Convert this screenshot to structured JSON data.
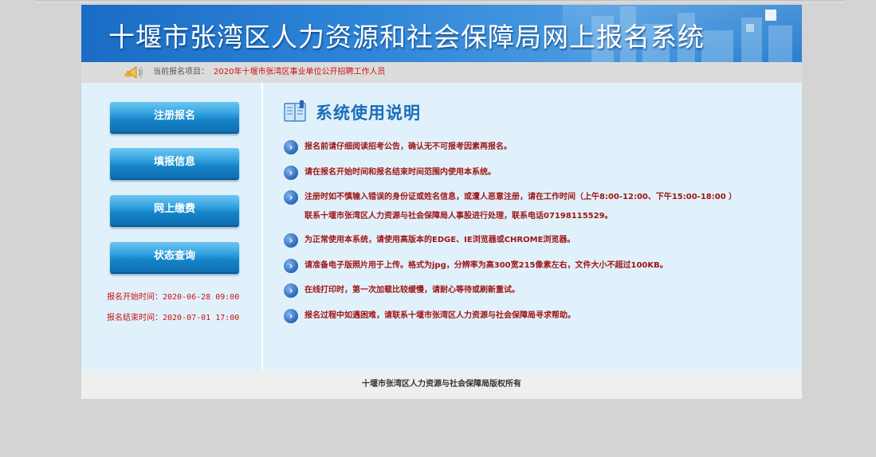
{
  "banner": {
    "title": "十堰市张湾区人力资源和社会保障局网上报名系统"
  },
  "notice": {
    "label": "当前报名项目：",
    "project": "2020年十堰市张湾区事业单位公开招聘工作人员",
    "icon": "speaker-icon"
  },
  "sidebar": {
    "nav": [
      {
        "label": "注册报名"
      },
      {
        "label": "填报信息"
      },
      {
        "label": "网上缴费"
      },
      {
        "label": "状态查询"
      }
    ],
    "start_time": "报名开始时间：2020-06-28 09:00",
    "end_time": "报名结束时间：2020-07-01 17:00"
  },
  "instructions": {
    "title": "系统使用说明",
    "icon": "book-icon",
    "items": [
      "报名前请仔细阅读招考公告，确认无不可报考因素再报名。",
      "请在报名开始时间和报名结束时间范围内使用本系统。",
      "注册时如不慎输入错误的身份证或姓名信息，或遭人恶意注册，请在工作时间（上午8:00-12:00、下午15:00-18:00 ）联系十堰市张湾区人力资源与社会保障局人事股进行处理，联系电话07198115529。",
      "为正常使用本系统，请使用高版本的EDGE、IE浏览器或CHROME浏览器。",
      "请准备电子版照片用于上传。格式为jpg，分辨率为高300宽215像素左右，文件大小不超过100KB。",
      "在线打印时，第一次加载比较缓慢，请耐心等待或刷新重试。",
      "报名过程中如遇困难，请联系十堰市张湾区人力资源与社会保障局寻求帮助。"
    ]
  },
  "footer": {
    "copyright": "十堰市张湾区人力资源与社会保障局版权所有"
  }
}
